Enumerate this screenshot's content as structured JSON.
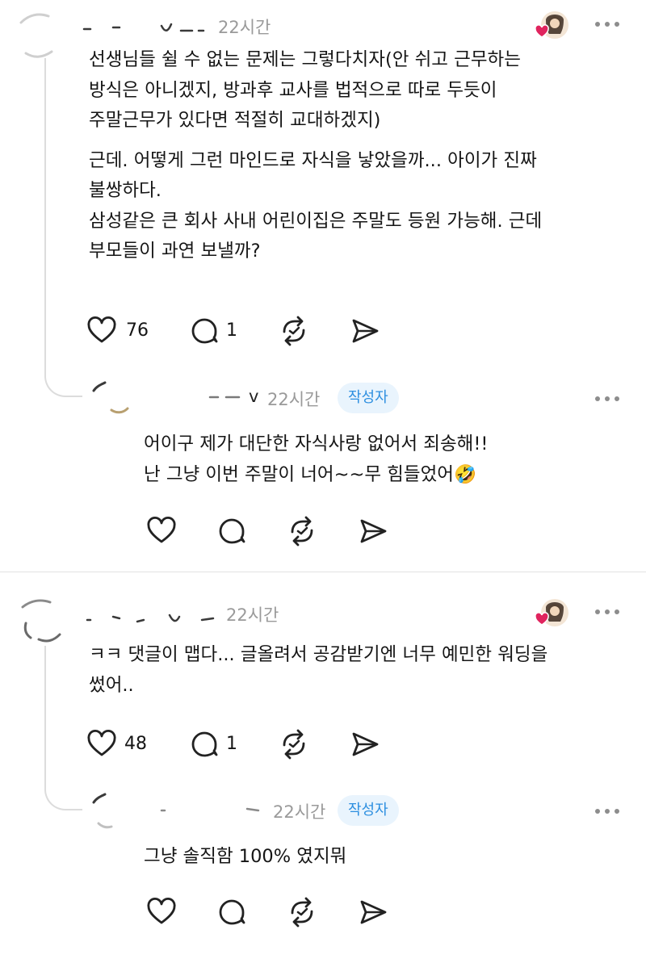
{
  "comments": [
    {
      "time": "22시간",
      "body": [
        "선생님들 쉴 수 없는 문제는 그렇다치자(안 쉬고 근무하는",
        "방식은 아니겠지, 방과후 교사를 법적으로 따로 두듯이",
        "주말근무가 있다면 적절히 교대하겠지)",
        "근데. 어떻게 그런 마인드로 자식을 낳았을까... 아이가 진짜",
        "불쌍하다.",
        "삼성같은 큰 회사 사내 어린이집은 주말도 등원 가능해. 근데",
        "부모들이 과연 보낼까?"
      ],
      "likes": "76",
      "replies": "1",
      "liked_by_author": true
    },
    {
      "time": "22시간",
      "author_label": "작성자",
      "handle_fragment": "v",
      "body": [
        "어이구 제가 대단한 자식사랑 없어서 죄송해!!",
        "난 그냥 이번 주말이 너어~~무 힘들었어🤣"
      ]
    },
    {
      "time": "22시간",
      "body": [
        "ㅋㅋ 댓글이 맵다... 글올려서 공감받기엔 너무 예민한 워딩을",
        "썼어.."
      ],
      "likes": "48",
      "replies": "1",
      "liked_by_author": true
    },
    {
      "time": "22시간",
      "author_label": "작성자",
      "body": [
        "그냥 솔직함 100% 였지뭐"
      ]
    }
  ],
  "icons": {
    "like": "heart-outline-icon",
    "reply": "speech-bubble-icon",
    "repost": "repost-arrows-icon",
    "share": "send-paper-plane-icon",
    "more": "more-horizontal-icon"
  },
  "colors": {
    "badge_bg": "#e9f4fd",
    "badge_text": "#2d8fe0",
    "heart": "#e0245e",
    "muted": "#9a9a9a"
  }
}
